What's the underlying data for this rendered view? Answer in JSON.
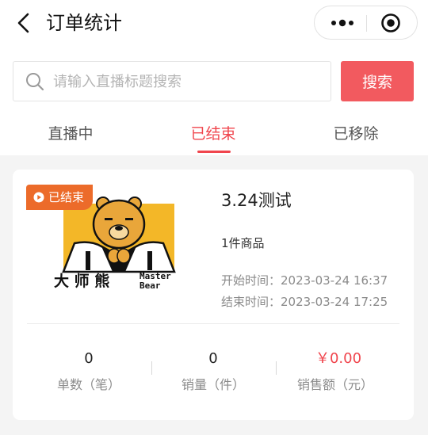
{
  "nav": {
    "title": "订单统计"
  },
  "search": {
    "placeholder": "请输入直播标题搜索",
    "value": "",
    "button_label": "搜索"
  },
  "tabs": [
    {
      "label": "直播中",
      "active": false
    },
    {
      "label": "已结束",
      "active": true
    },
    {
      "label": "已移除",
      "active": false
    }
  ],
  "accent_color": "#f0454d",
  "card": {
    "badge": "已结束",
    "cover": {
      "brand_text": "大师熊 Master Bear"
    },
    "title": "3.24测试",
    "goods_count": "1件商品",
    "start_time": "开始时间：2023-03-24 16:37",
    "end_time": "结束时间：2023-03-24 17:25",
    "stats": [
      {
        "value": "0",
        "label": "单数（笔）"
      },
      {
        "value": "0",
        "label": "销量（件）"
      },
      {
        "value": "￥0.00",
        "label": "销售额（元）"
      }
    ]
  }
}
